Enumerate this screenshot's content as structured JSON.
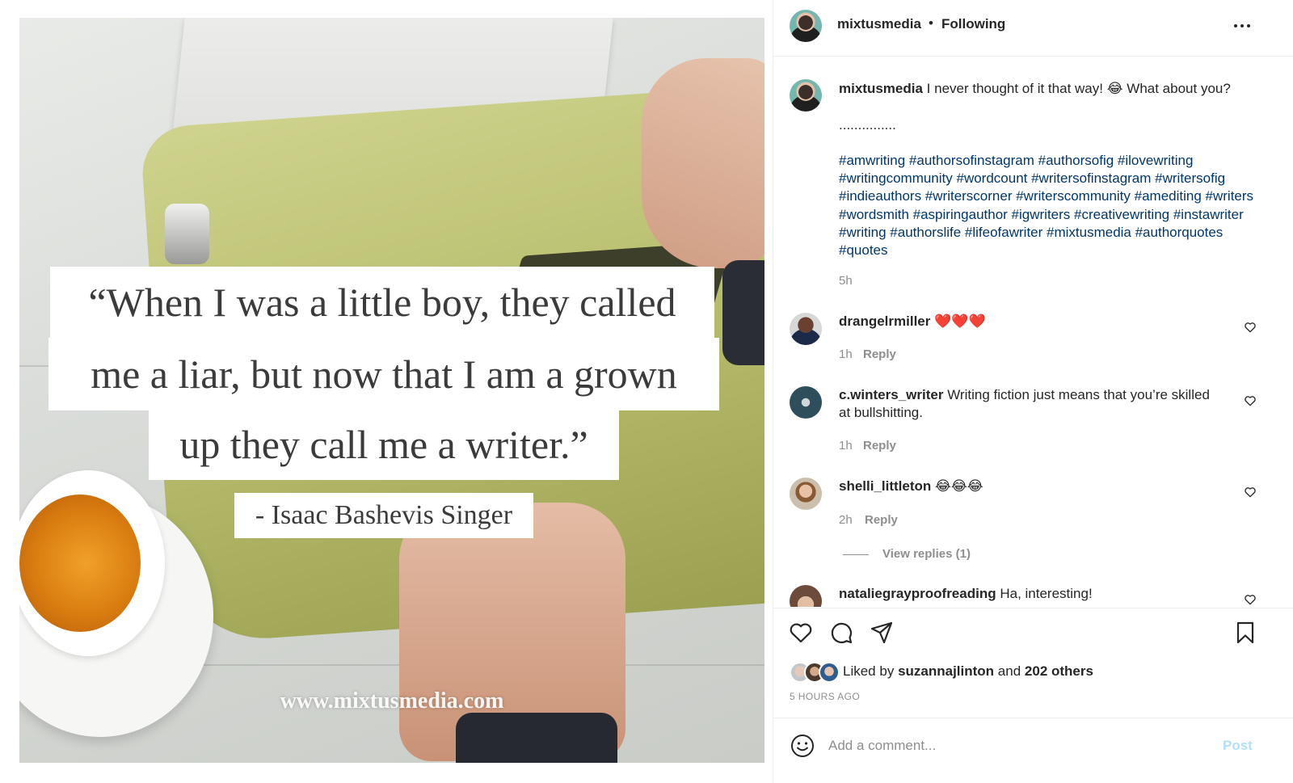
{
  "post_image": {
    "quote_lines": [
      "“When I was a little boy, they called",
      "me a liar, but now that I am a grown",
      "up they call me a writer.”"
    ],
    "attribution": "- Isaac Bashevis Singer",
    "watermark": "www.mixtusmedia.com"
  },
  "header": {
    "username": "mixtusmedia",
    "separator": "•",
    "follow_status": "Following",
    "more_icon": "more-horizontal-icon"
  },
  "caption": {
    "username": "mixtusmedia",
    "text": "I never thought of it that way! 😂 What about you?",
    "dots": "...............",
    "hashtags": "#amwriting #authorsofinstagram #authorsofig #ilovewriting #writingcommunity #wordcount #writersofinstagram #writersofig #indieauthors #writerscorner #writerscommunity #amediting #writers #wordsmith #aspiringauthor #igwriters #creativewriting #instawriter #writing #authorslife #lifeofawriter #mixtusmedia #authorquotes #quotes",
    "time": "5h"
  },
  "comments": [
    {
      "username": "drangelrmiller",
      "text": "❤️❤️❤️",
      "time": "1h",
      "reply": "Reply"
    },
    {
      "username": "c.winters_writer",
      "text": "Writing fiction just means that you’re skilled at bullshitting.",
      "time": "1h",
      "reply": "Reply"
    },
    {
      "username": "shelli_littleton",
      "text": "😂😂😂",
      "time": "2h",
      "reply": "Reply",
      "view_replies": "View replies (1)"
    },
    {
      "username": "nataliegrayproofreading",
      "text": "Ha, interesting!"
    }
  ],
  "actions": {
    "icons": [
      "heart-icon",
      "comment-icon",
      "share-icon",
      "bookmark-icon"
    ],
    "liked_prefix": "Liked by",
    "liked_user": "suzannajlinton",
    "liked_and": "and",
    "liked_others": "202 others",
    "time_ago": "5 HOURS AGO"
  },
  "add_comment": {
    "placeholder": "Add a comment...",
    "post_label": "Post",
    "emoji_icon": "smile-icon"
  },
  "colors": {
    "hashtag": "#00376b",
    "muted": "#8e8e8e",
    "post_button": "#b2dffc",
    "text": "#262626"
  }
}
